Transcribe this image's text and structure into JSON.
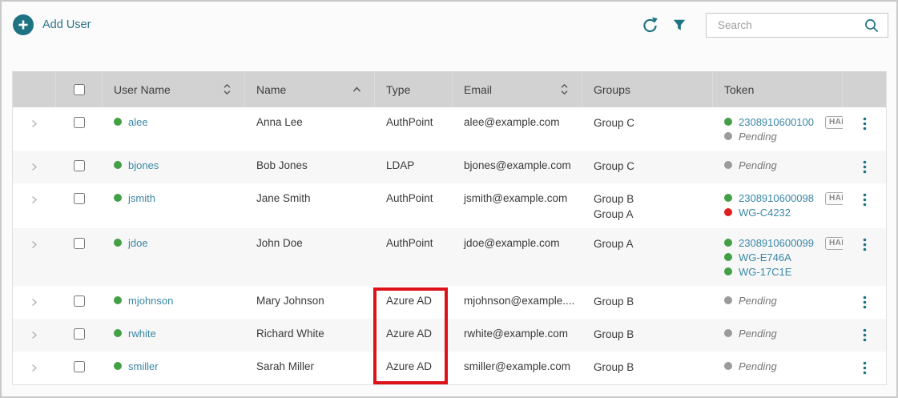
{
  "toolbar": {
    "add_user_label": "Add User",
    "search_placeholder": "Search"
  },
  "table": {
    "columns": [
      {
        "key": "expand",
        "label": "",
        "sort": null
      },
      {
        "key": "select",
        "label": "",
        "sort": null,
        "checkbox": true
      },
      {
        "key": "username",
        "label": "User Name",
        "sort": "both"
      },
      {
        "key": "name",
        "label": "Name",
        "sort": "asc"
      },
      {
        "key": "type",
        "label": "Type",
        "sort": null
      },
      {
        "key": "email",
        "label": "Email",
        "sort": "both"
      },
      {
        "key": "groups",
        "label": "Groups",
        "sort": null
      },
      {
        "key": "token",
        "label": "Token",
        "sort": null
      },
      {
        "key": "actions",
        "label": "",
        "sort": null
      }
    ],
    "rows": [
      {
        "status": "green",
        "username": "alee",
        "name": "Anna Lee",
        "type": "AuthPoint",
        "email": "alee@example.com",
        "groups": [
          "Group C"
        ],
        "tokens": [
          {
            "status": "green",
            "text": "2308910600100",
            "kind": "link",
            "badge": "HARD"
          },
          {
            "status": "gray",
            "text": "Pending",
            "kind": "pending"
          }
        ]
      },
      {
        "status": "green",
        "username": "bjones",
        "name": "Bob Jones",
        "type": "LDAP",
        "email": "bjones@example.com",
        "groups": [
          "Group C"
        ],
        "tokens": [
          {
            "status": "gray",
            "text": "Pending",
            "kind": "pending"
          }
        ]
      },
      {
        "status": "green",
        "username": "jsmith",
        "name": "Jane Smith",
        "type": "AuthPoint",
        "email": "jsmith@example.com",
        "groups": [
          "Group B",
          "Group A"
        ],
        "tokens": [
          {
            "status": "green",
            "text": "2308910600098",
            "kind": "link",
            "badge": "HARD"
          },
          {
            "status": "red",
            "text": "WG-C4232",
            "kind": "link"
          }
        ]
      },
      {
        "status": "green",
        "username": "jdoe",
        "name": "John Doe",
        "type": "AuthPoint",
        "email": "jdoe@example.com",
        "groups": [
          "Group A"
        ],
        "tokens": [
          {
            "status": "green",
            "text": "2308910600099",
            "kind": "link",
            "badge": "HARD"
          },
          {
            "status": "green",
            "text": "WG-E746A",
            "kind": "link"
          },
          {
            "status": "green",
            "text": "WG-17C1E",
            "kind": "link"
          }
        ]
      },
      {
        "status": "green",
        "username": "mjohnson",
        "name": "Mary Johnson",
        "type": "Azure AD",
        "email": "mjohnson@example....",
        "groups": [
          "Group B"
        ],
        "tokens": [
          {
            "status": "gray",
            "text": "Pending",
            "kind": "pending"
          }
        ],
        "highlight": "top"
      },
      {
        "status": "green",
        "username": "rwhite",
        "name": "Richard White",
        "type": "Azure AD",
        "email": "rwhite@example.com",
        "groups": [
          "Group B"
        ],
        "tokens": [
          {
            "status": "gray",
            "text": "Pending",
            "kind": "pending"
          }
        ],
        "highlight": "middle"
      },
      {
        "status": "green",
        "username": "smiller",
        "name": "Sarah Miller",
        "type": "Azure AD",
        "email": "smiller@example.com",
        "groups": [
          "Group B"
        ],
        "tokens": [
          {
            "status": "gray",
            "text": "Pending",
            "kind": "pending"
          }
        ],
        "highlight": "bottom"
      }
    ]
  },
  "annotation": {
    "description": "red box highlighting Azure AD type cells",
    "highlighted_rows": [
      "mjohnson",
      "rwhite",
      "smiller"
    ],
    "column": "type"
  },
  "colors": {
    "accent": "#1e7382",
    "link": "#3a87a6",
    "status_green": "#43a047",
    "status_gray": "#9b9b9b",
    "status_red": "#e11e1e",
    "highlight_red": "#dc1218",
    "header_bg": "#d2d2d2",
    "row_alt": "#f7f7f7"
  }
}
